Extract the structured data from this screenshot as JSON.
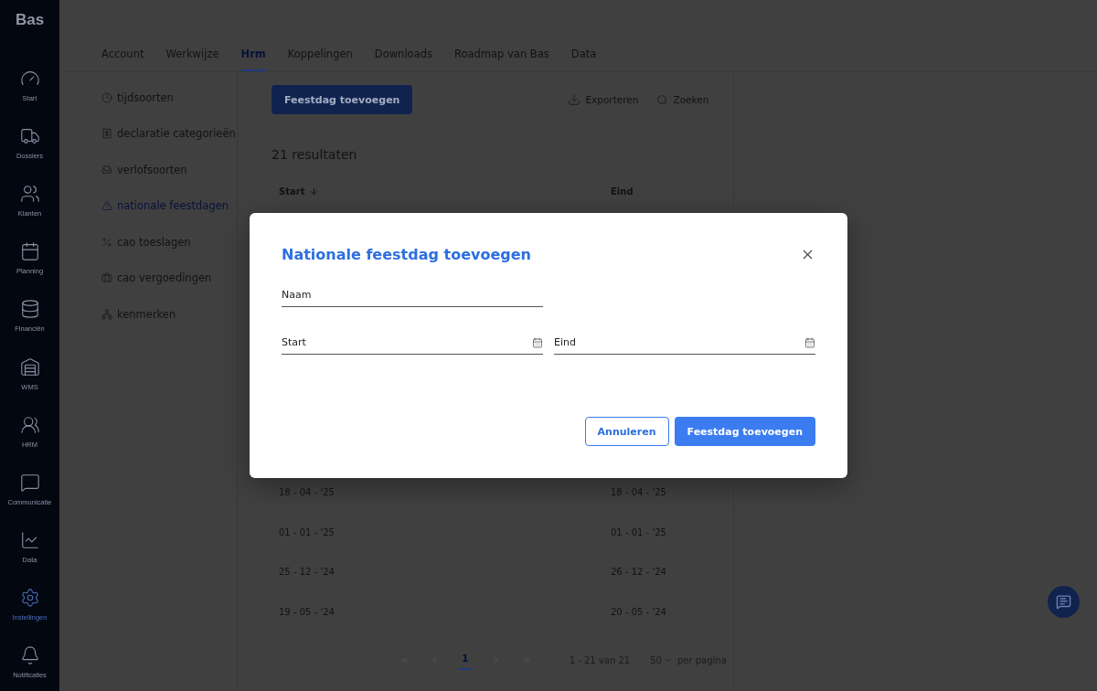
{
  "logo": "Bas",
  "sidebar": {
    "items": [
      {
        "label": "Start",
        "selected": false
      },
      {
        "label": "Dossiers",
        "selected": false
      },
      {
        "label": "Klanten",
        "selected": false
      },
      {
        "label": "Planning",
        "selected": false
      },
      {
        "label": "Financiën",
        "selected": false
      },
      {
        "label": "WMS",
        "selected": false
      },
      {
        "label": "HRM",
        "selected": false
      },
      {
        "label": "Communicatie",
        "selected": false
      },
      {
        "label": "Data",
        "selected": false
      },
      {
        "label": "Instellingen",
        "selected": true
      },
      {
        "label": "Notificaties",
        "selected": false
      }
    ]
  },
  "tabs": [
    {
      "label": "Account",
      "selected": false
    },
    {
      "label": "Werkwijze",
      "selected": false
    },
    {
      "label": "Hrm",
      "selected": true
    },
    {
      "label": "Koppelingen",
      "selected": false
    },
    {
      "label": "Downloads",
      "selected": false
    },
    {
      "label": "Roadmap van Bas",
      "selected": false
    },
    {
      "label": "Data",
      "selected": false
    }
  ],
  "submenu": [
    {
      "label": "tijdsoorten",
      "selected": false
    },
    {
      "label": "declaratie categorieën",
      "selected": false
    },
    {
      "label": "verlofsoorten",
      "selected": false
    },
    {
      "label": "nationale feestdagen",
      "selected": true
    },
    {
      "label": "cao toeslagen",
      "selected": false
    },
    {
      "label": "cao vergoedingen",
      "selected": false
    },
    {
      "label": "kenmerken",
      "selected": false
    }
  ],
  "toolbar": {
    "add_button": "Feestdag toevoegen",
    "export": "Exporteren",
    "search": "Zoeken"
  },
  "results": "21 resultaten",
  "table": {
    "columns": [
      "Start",
      "Eind"
    ],
    "rows": [
      [
        "18 - 04 - '25",
        "18 - 04 - '25"
      ],
      [
        "01 - 01 - '25",
        "01 - 01 - '25"
      ],
      [
        "25 - 12 - '24",
        "26 - 12 - '24"
      ],
      [
        "19 - 05 - '24",
        "20 - 05 - '24"
      ]
    ]
  },
  "pagination": {
    "pages": [
      {
        "label": "1",
        "selected": true
      }
    ],
    "range": "1 - 21 van 21",
    "page_size": "50",
    "per_page": "per pagina"
  },
  "dialog": {
    "title": "Nationale feestdag toevoegen",
    "fields": [
      {
        "placeholder": "Naam"
      },
      {
        "placeholder": "Start"
      },
      {
        "placeholder": "Eind"
      }
    ],
    "cancel": "Annuleren",
    "submit": "Feestdag toevoegen"
  }
}
